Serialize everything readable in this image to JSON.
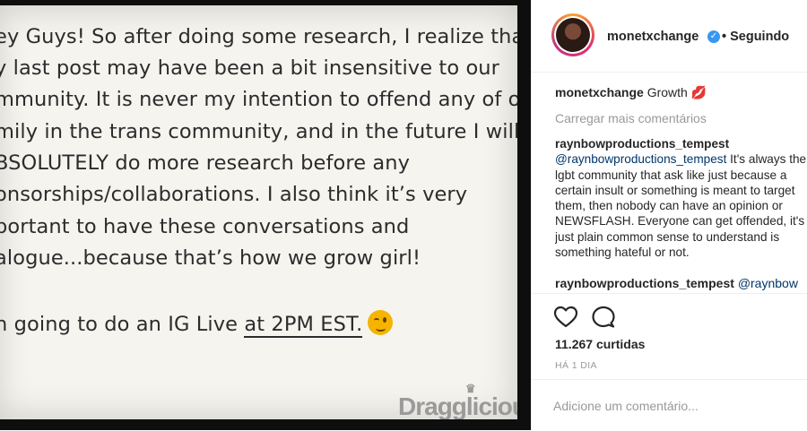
{
  "post_image": {
    "lines": [
      "ey Guys! So after doing some research, I realize that",
      "y last post may have been a bit insensitive to our",
      "mmunity. It is never my intention to offend any of our",
      "mily in the trans community, and in the future I will",
      "BSOLUTELY do more research before any",
      "onsorships/collaborations. I also think it’s very",
      "portant to have these conversations and",
      "alogue...because that’s how we grow girl!"
    ],
    "last_line_prefix": "n going to do an IG Live ",
    "last_line_underlined": "at 2PM EST.",
    "watermark": "Dragglicious"
  },
  "header": {
    "username": "monetxchange",
    "verified": "✓",
    "follow_status": "• Seguindo"
  },
  "caption": {
    "username": "monetxchange",
    "text": "Growth",
    "emoji": "💋"
  },
  "load_more": "Carregar mais comentários",
  "comments": [
    {
      "username": "raynbowproductions_tempest",
      "mention": "@raynbowproductions_tempest",
      "text": "It's always the lgbt community that ask like just because a certain insult or something is meant to target them, then nobody can have an opinion or NEWSFLASH. Everyone can get offended, it's just plain common sense to understand is something hateful or not."
    },
    {
      "username": "raynbowproductions_tempest",
      "mention": "@raynbow"
    }
  ],
  "actions": {
    "like_icon": "heart-icon",
    "comment_icon": "comment-icon",
    "likes": "11.267 curtidas",
    "time": "HÁ 1 DIA"
  },
  "add_comment": {
    "placeholder": "Adicione um comentário..."
  }
}
